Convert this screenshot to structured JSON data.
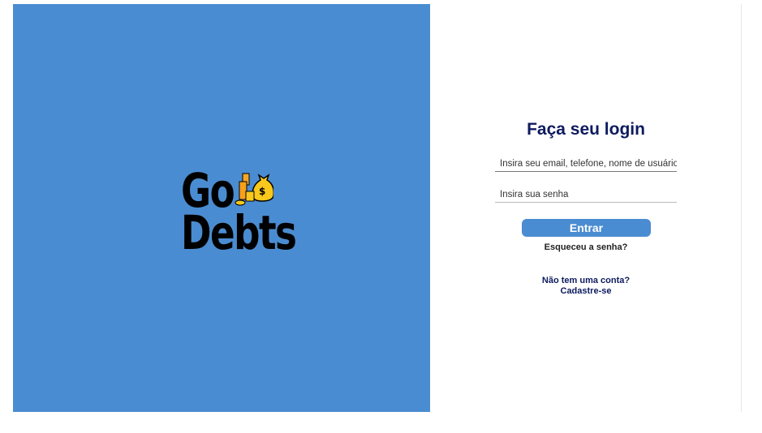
{
  "logo": {
    "line1": "Go",
    "line2": "Debts",
    "icon": "money-bag-coins-icon"
  },
  "login": {
    "title": "Faça seu login",
    "user_placeholder": "Insira seu email, telefone, nome de usuário",
    "password_placeholder": "Insira sua senha",
    "submit_label": "Entrar",
    "forgot_label": "Esqueceu a senha?",
    "no_account_label": "Não tem uma conta?",
    "signup_label": "Cadastre-se"
  },
  "colors": {
    "brand": "#4a8cd1",
    "title": "#0d1b5e"
  }
}
